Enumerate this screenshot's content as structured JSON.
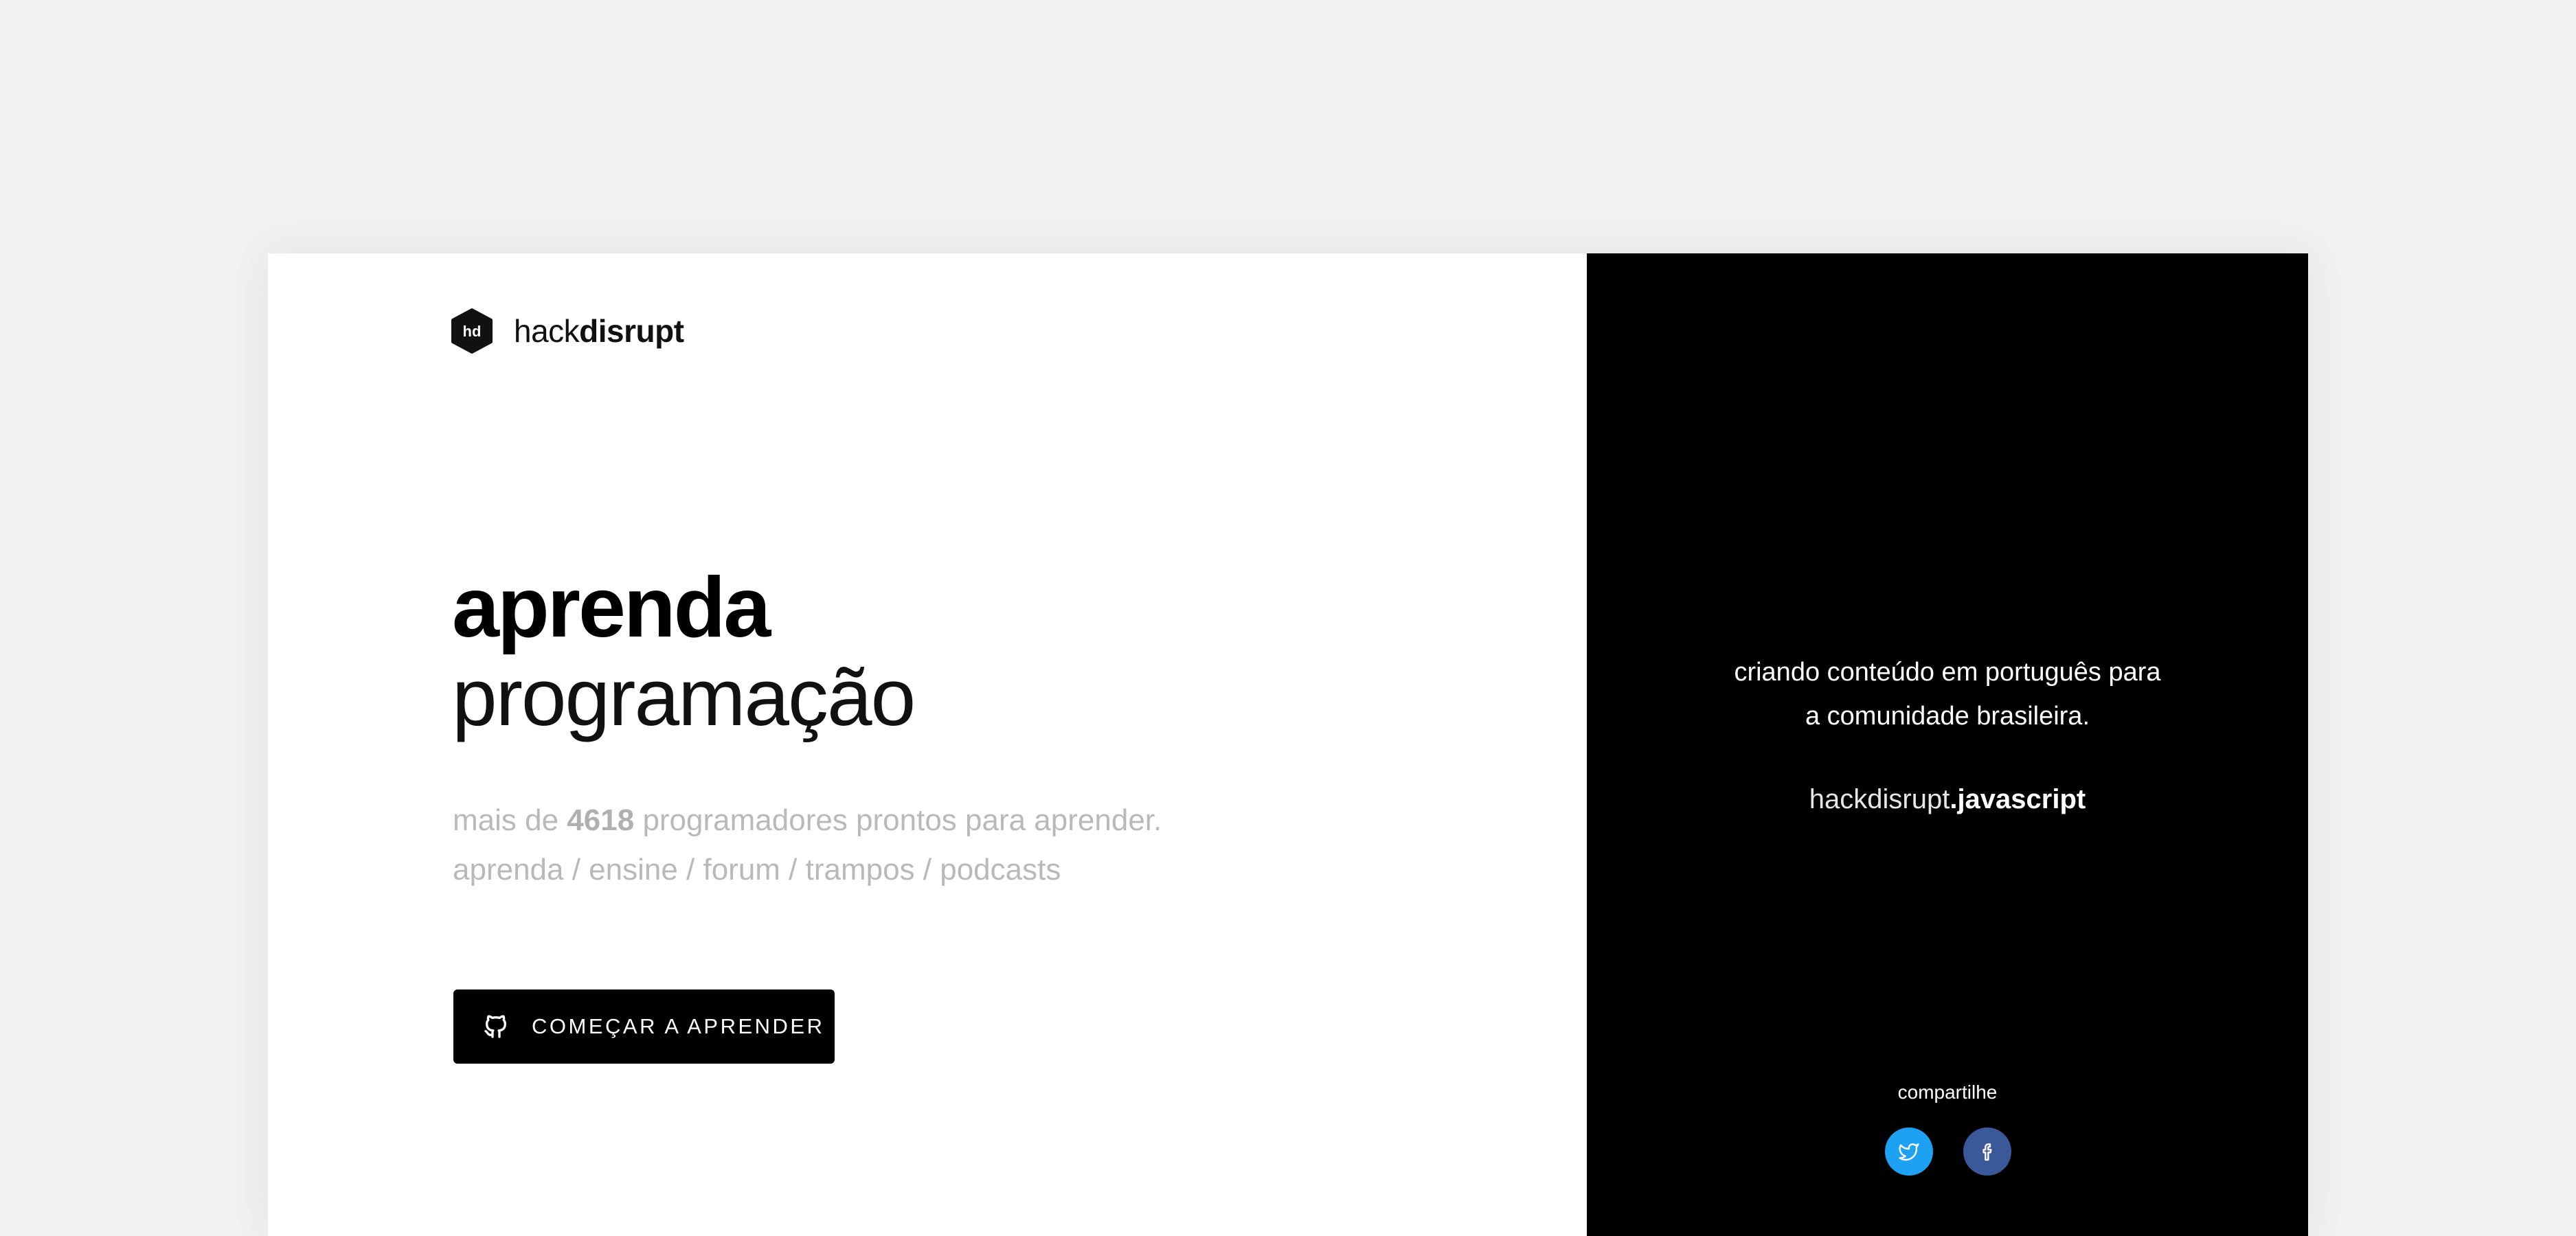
{
  "brand": {
    "logo_mark": "hd",
    "name_light": "hack",
    "name_bold": "disrupt"
  },
  "hero": {
    "title_bold": "aprenda",
    "title_light": "programação",
    "sub_prefix": "mais de",
    "sub_count": "4618",
    "sub_suffix": "programadores prontos para aprender.",
    "sub_links": "aprenda / ensine / forum / trampos / podcasts"
  },
  "cta": {
    "label": "COMEÇAR A APRENDER",
    "icon": "github-icon"
  },
  "side": {
    "mission_line1": "criando conteúdo em português para",
    "mission_line2": "a comunidade brasileira.",
    "domain_light": "hackdisrupt",
    "domain_bold": ".javascript",
    "share_label": "compartilhe"
  },
  "social": [
    {
      "name": "twitter",
      "icon": "twitter-icon",
      "color": "#1da1f2"
    },
    {
      "name": "facebook",
      "icon": "facebook-icon",
      "color": "#3b5998"
    }
  ],
  "colors": {
    "page_bg": "#f1f1f1",
    "panel_dark": "#000000",
    "muted_text": "#b9b9b9"
  }
}
